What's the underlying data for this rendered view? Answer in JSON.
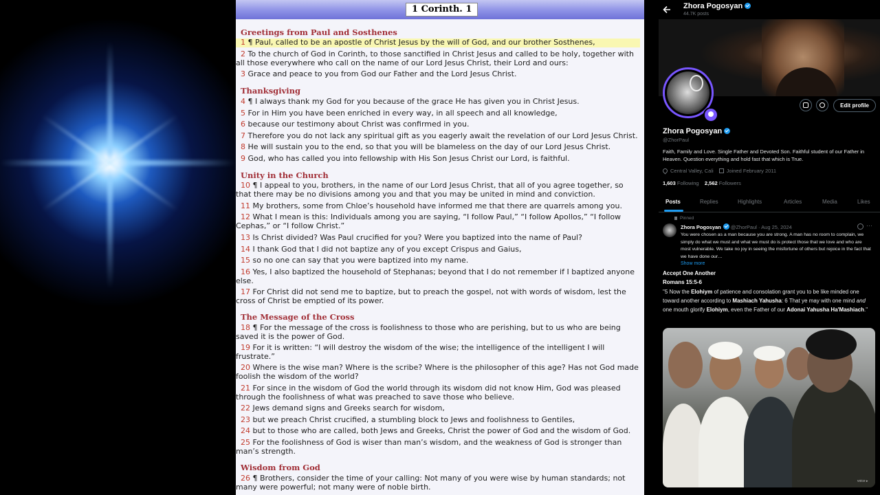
{
  "bible": {
    "reference": "1 Corinth. 1",
    "headings": {
      "h1": "Greetings from Paul and Sosthenes",
      "h2": "Thanksgiving",
      "h3": "Unity in the Church",
      "h4": "The Message of the Cross",
      "h5": "Wisdom from God"
    },
    "verses": [
      {
        "num": "1",
        "text": "¶ Paul, called to be an apostle of Christ Jesus by the will of God, and our brother Sosthenes,"
      },
      {
        "num": "2",
        "text": "To the church of God in Corinth, to those sanctified in Christ Jesus and called to be holy, together with all those everywhere who call on the name of our Lord Jesus Christ, their Lord and ours:"
      },
      {
        "num": "3",
        "text": "Grace and peace to you from God our Father and the Lord Jesus Christ."
      },
      {
        "num": "4",
        "text": "¶ I always thank my God for you because of the grace He has given you in Christ Jesus."
      },
      {
        "num": "5",
        "text": "For in Him you have been enriched in every way, in all speech and all knowledge,"
      },
      {
        "num": "6",
        "text": "because our testimony about Christ was confirmed in you."
      },
      {
        "num": "7",
        "text": "Therefore you do not lack any spiritual gift as you eagerly await the revelation of our Lord Jesus Christ."
      },
      {
        "num": "8",
        "text": "He will sustain you to the end, so that you will be blameless on the day of our Lord Jesus Christ."
      },
      {
        "num": "9",
        "text": "God, who has called you into fellowship with His Son Jesus Christ our Lord, is faithful."
      },
      {
        "num": "10",
        "text": "¶ I appeal to you, brothers, in the name of our Lord Jesus Christ, that all of you agree together, so that there may be no divisions among you and that you may be united in mind and conviction."
      },
      {
        "num": "11",
        "text": "My brothers, some from Chloe’s household have informed me that there are quarrels among you."
      },
      {
        "num": "12",
        "text": "What I mean is this: Individuals among you are saying, “I follow Paul,” “I follow Apollos,” “I follow Cephas,” or “I follow Christ.”"
      },
      {
        "num": "13",
        "text": "Is Christ divided? Was Paul crucified for you? Were you baptized into the name of Paul?"
      },
      {
        "num": "14",
        "text": "I thank God that I did not baptize any of you except Crispus and Gaius,"
      },
      {
        "num": "15",
        "text": "so no one can say that you were baptized into my name."
      },
      {
        "num": "16",
        "text": "Yes, I also baptized the household of Stephanas; beyond that I do not remember if I baptized anyone else."
      },
      {
        "num": "17",
        "text": "For Christ did not send me to baptize, but to preach the gospel, not with words of wisdom, lest the cross of Christ be emptied of its power."
      },
      {
        "num": "18",
        "text": "¶ For the message of the cross is foolishness to those who are perishing, but to us who are being saved it is the power of God."
      },
      {
        "num": "19",
        "text": "For it is written: “I will destroy the wisdom of the wise; the intelligence of the intelligent I will frustrate.”"
      },
      {
        "num": "20",
        "text": "Where is the wise man? Where is the scribe? Where is the philosopher of this age? Has not God made foolish the wisdom of the world?"
      },
      {
        "num": "21",
        "text": "For since in the wisdom of God the world through its wisdom did not know Him, God was pleased through the foolishness of what was preached to save those who believe."
      },
      {
        "num": "22",
        "text": "Jews demand signs and Greeks search for wisdom,"
      },
      {
        "num": "23",
        "text": "but we preach Christ crucified, a stumbling block to Jews and foolishness to Gentiles,"
      },
      {
        "num": "24",
        "text": "but to those who are called, both Jews and Greeks, Christ the power of God and the wisdom of God."
      },
      {
        "num": "25",
        "text": "For the foolishness of God is wiser than man’s wisdom, and the weakness of God is stronger than man’s strength."
      },
      {
        "num": "26",
        "text": "¶ Brothers, consider the time of your calling: Not many of you were wise by human standards; not many were powerful; not many were of noble birth."
      }
    ]
  },
  "profile": {
    "header_name": "Zhora Pogosyan",
    "header_posts": "44.7K posts",
    "name": "Zhora Pogosyan",
    "handle": "@ZhorPaul",
    "edit_profile": "Edit profile",
    "bio": "Faith, Family and Love. Single Father and Devoted Son. Faithful student of our Father in Heaven. Question everything and hold fast that which is True.",
    "location": "Central Valley, Cali",
    "joined": "Joined February 2011",
    "following_count": "1,603",
    "following_label": "Following",
    "followers_count": "2,562",
    "followers_label": "Followers",
    "tabs": [
      "Posts",
      "Replies",
      "Highlights",
      "Articles",
      "Media",
      "Likes"
    ],
    "accent_color": "#1d9bf0"
  },
  "post": {
    "pinned_label": "Pinned",
    "author": "Zhora Pogosyan",
    "handle_date": "@ZhorPaul · Aug 25, 2024",
    "more": "···",
    "text": "You were chosen as a man because you are strong. A man has no room to complain, we simply do what we must and what we must do is protect those that we love and who are most vulnerable. We take no joy in seeing the misfortune of others but rejoice in the fact that we have done our…",
    "show_more": "Show more",
    "title": "Accept One Another",
    "reference": "Romans 15:5-6",
    "verse_parts": {
      "a": "\"5 Now the ",
      "b": "Elohiym",
      "c": " of patience and consolation grant you to be like minded one toward another according to ",
      "d": "Mashiach Yahusha",
      "e": ": 6 That ye may with one mind ",
      "f": "and",
      "g": " one mouth glorify ",
      "h": "Elohiym",
      "i": ", even the Father of our ",
      "j": "Adonai Yahusha Ha'Mashiach",
      "k": ".\""
    },
    "image_watermark": "voice ▸"
  },
  "icons": {
    "back": "back-arrow-icon",
    "verified": "verified-badge-icon",
    "location": "location-pin-icon",
    "calendar": "calendar-icon",
    "pin": "pin-icon",
    "grok": "grok-icon"
  }
}
